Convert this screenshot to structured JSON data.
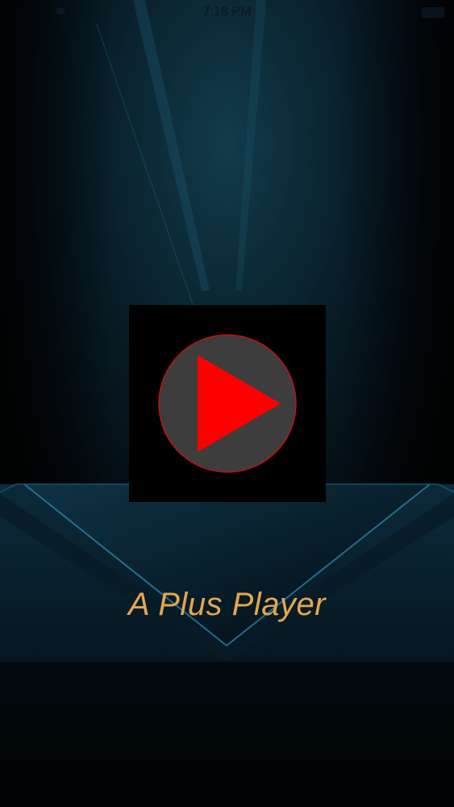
{
  "status_bar": {
    "time": "7:18 PM"
  },
  "splash": {
    "app_name": "A Plus Player",
    "logo_icon": "play-icon"
  },
  "colors": {
    "title": "#e3a651",
    "play_triangle": "#ff0000",
    "play_circle": "#3d3d3d",
    "background_glow": "#0f3a4d"
  }
}
